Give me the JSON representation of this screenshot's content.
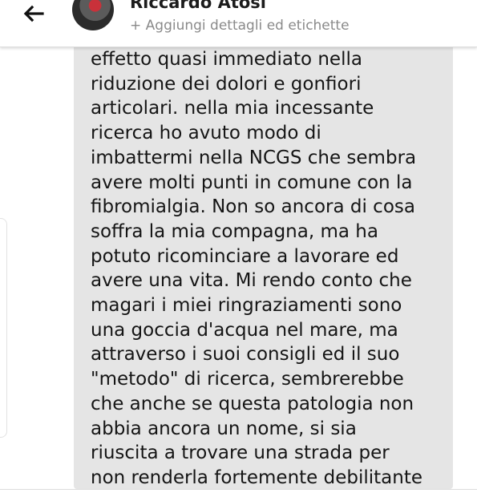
{
  "header": {
    "contact_name": "Riccardo Atosi",
    "add_details_label": "+ Aggiungi dettagli ed etichette",
    "back_icon": "arrow-left-icon"
  },
  "message": {
    "lines": [
      "effetto quasi immediato nella",
      "riduzione dei dolori e gonfiori",
      "articolari. nella mia incessante",
      "ricerca ho avuto modo di",
      "imbattermi nella NCGS che sembra",
      "avere molti punti in comune con la",
      "fibromialgia. Non so ancora di cosa",
      "soffra la mia compagna, ma ha",
      "potuto ricominciare a lavorare ed",
      "avere una vita. Mi rendo conto che",
      "magari i miei ringraziamenti sono",
      "una goccia d'acqua nel mare, ma",
      "attraverso i suoi consigli ed il suo",
      "\"metodo\" di ricerca, sembrerebbe",
      "che anche se questa patologia non",
      "abbia ancora un nome, si sia",
      "riuscita a trovare una strada per",
      "non renderla fortemente debilitante"
    ]
  },
  "colors": {
    "bubble_background": "#e5e5e5",
    "text": "#151515",
    "secondary_text": "#8a8a8a"
  }
}
